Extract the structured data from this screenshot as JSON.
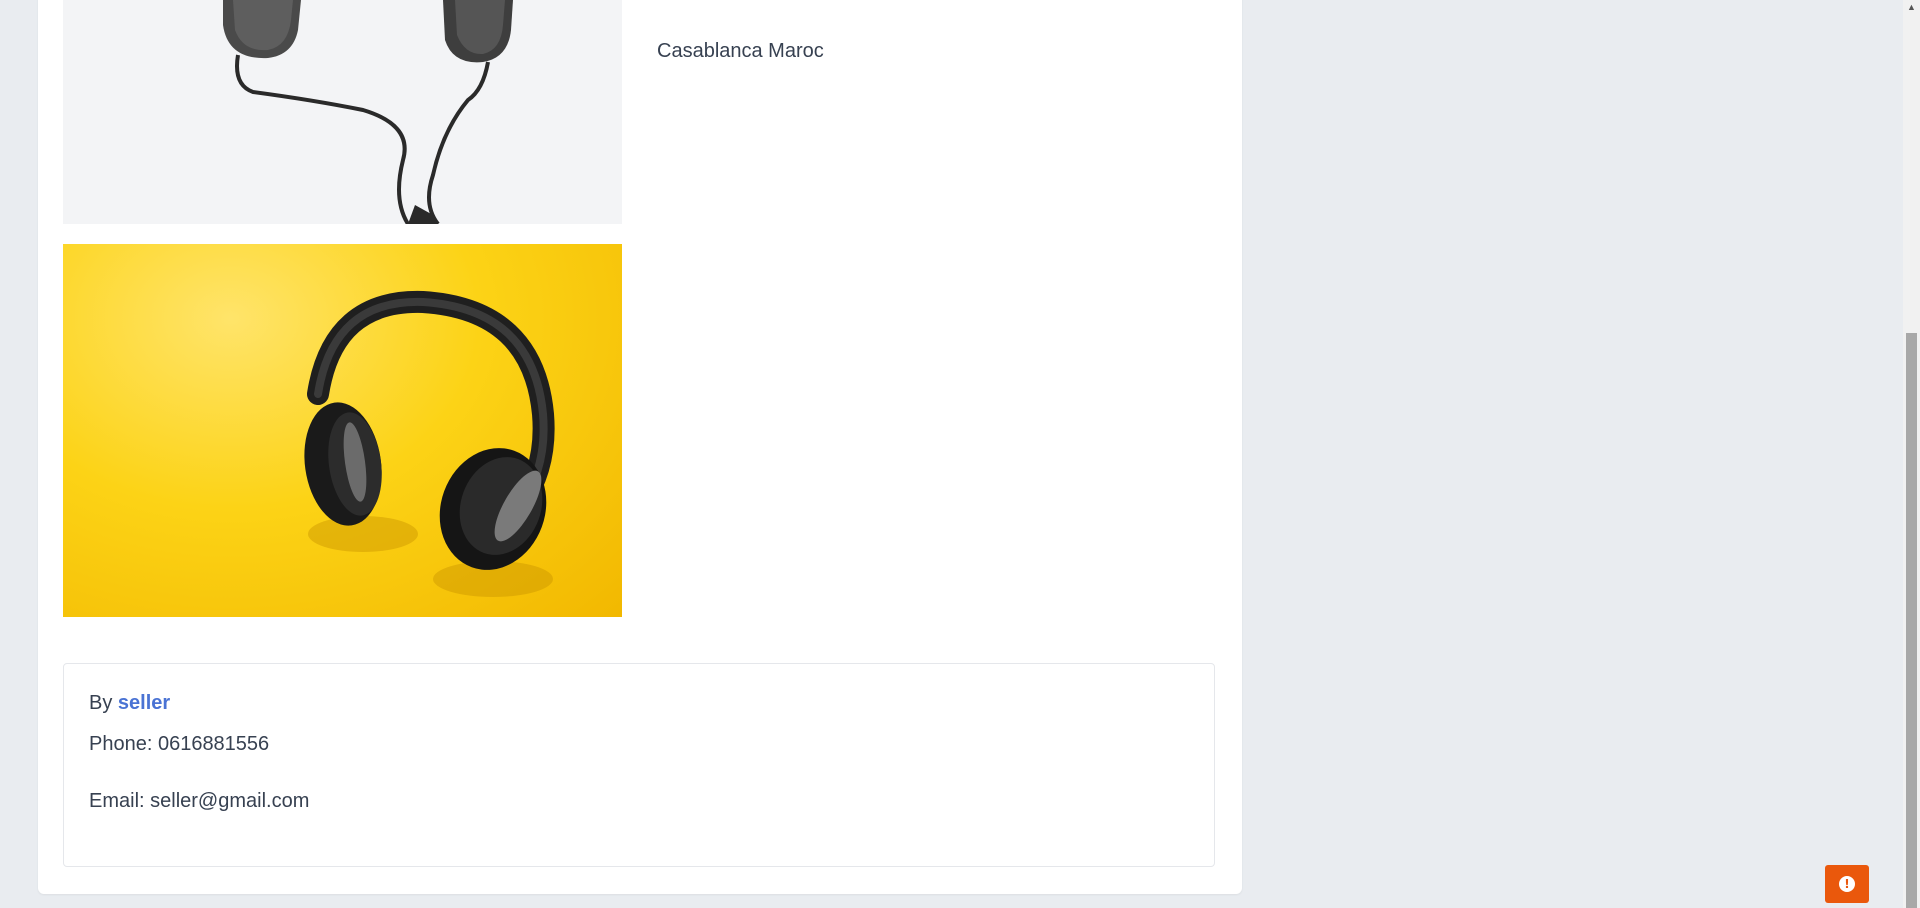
{
  "product": {
    "location": "Casablanca Maroc",
    "images": [
      {
        "name": "headphones-gray-background"
      },
      {
        "name": "headphones-yellow-background"
      }
    ]
  },
  "seller": {
    "by_label": "By",
    "name": "seller",
    "phone_label": "Phone: 0616881556",
    "email_label": "Email: seller@gmail.com"
  },
  "scrollbar": {
    "up_arrow": "▲"
  },
  "alert_button": {
    "icon": "!"
  },
  "colors": {
    "accent_link": "#4a73d4",
    "alert_button": "#ea580c",
    "page_background": "#e9ecf0"
  }
}
